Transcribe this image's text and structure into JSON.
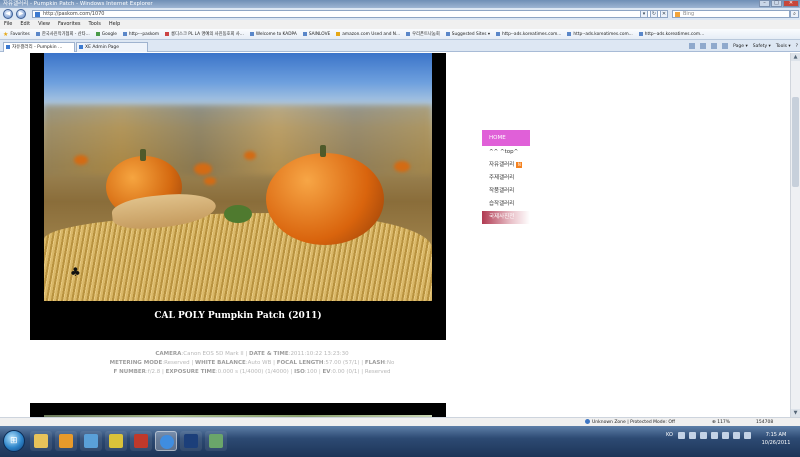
{
  "window": {
    "title": "자유갤러리 - Pumpkin Patch - Windows Internet Explorer",
    "minimize": "–",
    "maximize": "□",
    "close": "✕"
  },
  "address": {
    "url": "http://paskom.com/1070",
    "back": "◀",
    "forward": "▶",
    "refresh": "↻",
    "stop": "✕",
    "dropdown": "▾",
    "search_placeholder": "Bing",
    "search_button": "⌕"
  },
  "menu": [
    "File",
    "Edit",
    "View",
    "Favorites",
    "Tools",
    "Help"
  ],
  "favorites": {
    "label": "Favorites",
    "items": [
      "한국사진작가협회 - 산타...",
      "Google",
      "http---paskom",
      "롱디스크 PL LA 명예의 사진동호회 사...",
      "Welcome to KADPA",
      "SAINLOVE",
      "amazon.com Used and N...",
      "우리폰트나눔회",
      "Suggested Sites ▾",
      "http--ads.koreatimes.com...",
      "http--ads.koreatimes.com...",
      "http--ads.koreatimes.com..."
    ]
  },
  "tabs": [
    {
      "label": "자유갤러리 - Pumpkin ...",
      "active": true
    },
    {
      "label": "XE Admin Page",
      "active": false
    }
  ],
  "tabtools": [
    "Page ▾",
    "Safety ▾",
    "Tools ▾",
    "?"
  ],
  "photo": {
    "caption": "CAL POLY Pumpkin Patch   (2011)"
  },
  "exif": {
    "line1": [
      {
        "k": "CAMERA",
        "v": "Canon EOS 5D Mark II"
      },
      {
        "k": "DATE & TIME",
        "v": "2011:10:22 13:23:30"
      }
    ],
    "line2": [
      {
        "k": "METERING MODE",
        "v": "Reserved"
      },
      {
        "k": "WHITE BALANCE",
        "v": "Auto WB"
      },
      {
        "k": "FOCAL LENGTH",
        "v": "57.00 (57/1)"
      },
      {
        "k": "FLASH",
        "v": "No"
      }
    ],
    "line3": [
      {
        "k": "F NUMBER",
        "v": "f/2.8"
      },
      {
        "k": "EXPOSURE TIME",
        "v": "0.000 s (1/4000) (1/4000)"
      },
      {
        "k": "ISO",
        "v": "100"
      },
      {
        "k": "EV",
        "v": "0.00 (0/1)"
      },
      {
        "k": "",
        "v": "Reserved"
      }
    ]
  },
  "sidemenu": [
    {
      "label": "HOME",
      "kind": "home"
    },
    {
      "label": "^^  ^top^",
      "kind": "normal"
    },
    {
      "label": "자유갤러리",
      "kind": "normal",
      "badge": "N"
    },
    {
      "label": "주제갤러리",
      "kind": "normal"
    },
    {
      "label": "작품갤러리",
      "kind": "normal"
    },
    {
      "label": "습작갤러리",
      "kind": "normal"
    },
    {
      "label": "국제사진전",
      "kind": "special"
    }
  ],
  "status": {
    "zone": "Unknown Zone | Protected Mode: Off",
    "zoom": "117%",
    "counter": "154708"
  },
  "taskbar": {
    "lang": "KO",
    "time": "7:15 AM",
    "date": "10/26/2011"
  }
}
